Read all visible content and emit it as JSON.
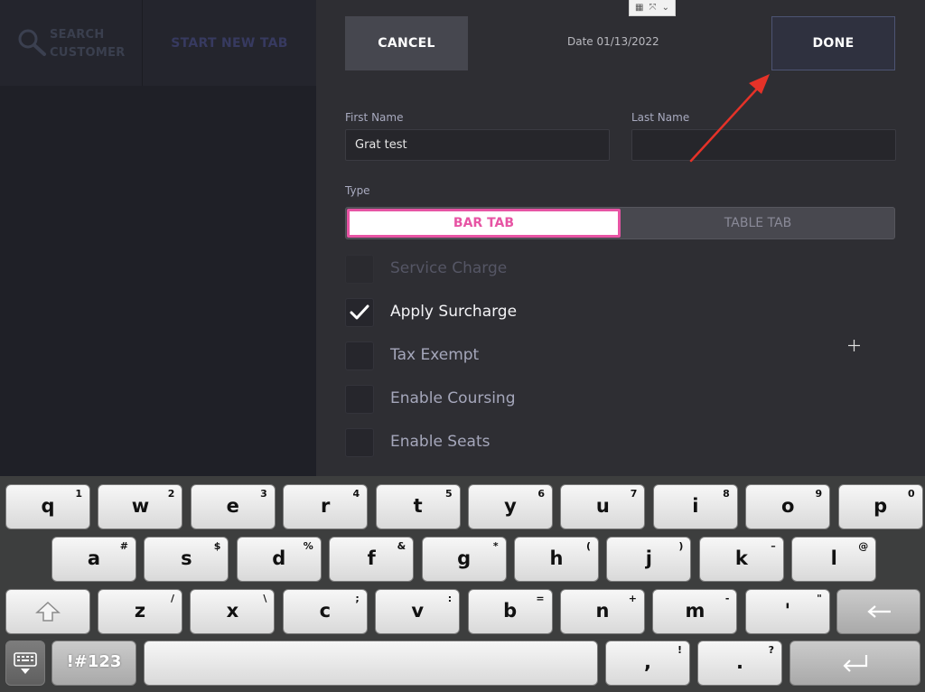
{
  "left": {
    "search_line1": "SEARCH",
    "search_line2": "CUSTOMER",
    "start_tab": "START NEW TAB"
  },
  "header": {
    "cancel": "CANCEL",
    "date": "Date 01/13/2022",
    "done": "DONE"
  },
  "form": {
    "first_name_label": "First Name",
    "first_name_value": "Grat test",
    "last_name_label": "Last Name",
    "last_name_value": "",
    "type_label": "Type",
    "type_options": [
      "BAR TAB",
      "TABLE TAB"
    ],
    "type_selected": "BAR TAB",
    "options": [
      {
        "label": "Service Charge",
        "checked": false,
        "enabled": false
      },
      {
        "label": "Apply Surcharge",
        "checked": true,
        "enabled": true
      },
      {
        "label": "Tax Exempt",
        "checked": false,
        "enabled": true
      },
      {
        "label": "Enable Coursing",
        "checked": false,
        "enabled": true
      },
      {
        "label": "Enable Seats",
        "checked": false,
        "enabled": true
      }
    ]
  },
  "colors": {
    "accent_pink": "#e754a4",
    "annotation_arrow": "#e53228"
  },
  "keyboard": {
    "row1": [
      {
        "k": "q",
        "s": "1"
      },
      {
        "k": "w",
        "s": "2"
      },
      {
        "k": "e",
        "s": "3"
      },
      {
        "k": "r",
        "s": "4"
      },
      {
        "k": "t",
        "s": "5"
      },
      {
        "k": "y",
        "s": "6"
      },
      {
        "k": "u",
        "s": "7"
      },
      {
        "k": "i",
        "s": "8"
      },
      {
        "k": "o",
        "s": "9"
      },
      {
        "k": "p",
        "s": "0"
      }
    ],
    "row2": [
      {
        "k": "a",
        "s": "#"
      },
      {
        "k": "s",
        "s": "$"
      },
      {
        "k": "d",
        "s": "%"
      },
      {
        "k": "f",
        "s": "&"
      },
      {
        "k": "g",
        "s": "*"
      },
      {
        "k": "h",
        "s": "("
      },
      {
        "k": "j",
        "s": ")"
      },
      {
        "k": "k",
        "s": "–"
      },
      {
        "k": "l",
        "s": "@"
      }
    ],
    "row3": [
      {
        "k": "z",
        "s": "/"
      },
      {
        "k": "x",
        "s": "\\"
      },
      {
        "k": "c",
        "s": ";"
      },
      {
        "k": "v",
        "s": ":"
      },
      {
        "k": "b",
        "s": "="
      },
      {
        "k": "n",
        "s": "+"
      },
      {
        "k": "m",
        "s": "-"
      },
      {
        "k": "'",
        "s": "\""
      }
    ],
    "row4": {
      "symbols": "!#123",
      "comma": {
        "k": ",",
        "s": "!"
      },
      "period": {
        "k": ".",
        "s": "?"
      }
    },
    "icons": {
      "shift": "shift-arrow-icon",
      "backspace": "backspace-arrow-icon",
      "hide": "keyboard-hide-icon",
      "enter": "enter-return-icon"
    }
  }
}
